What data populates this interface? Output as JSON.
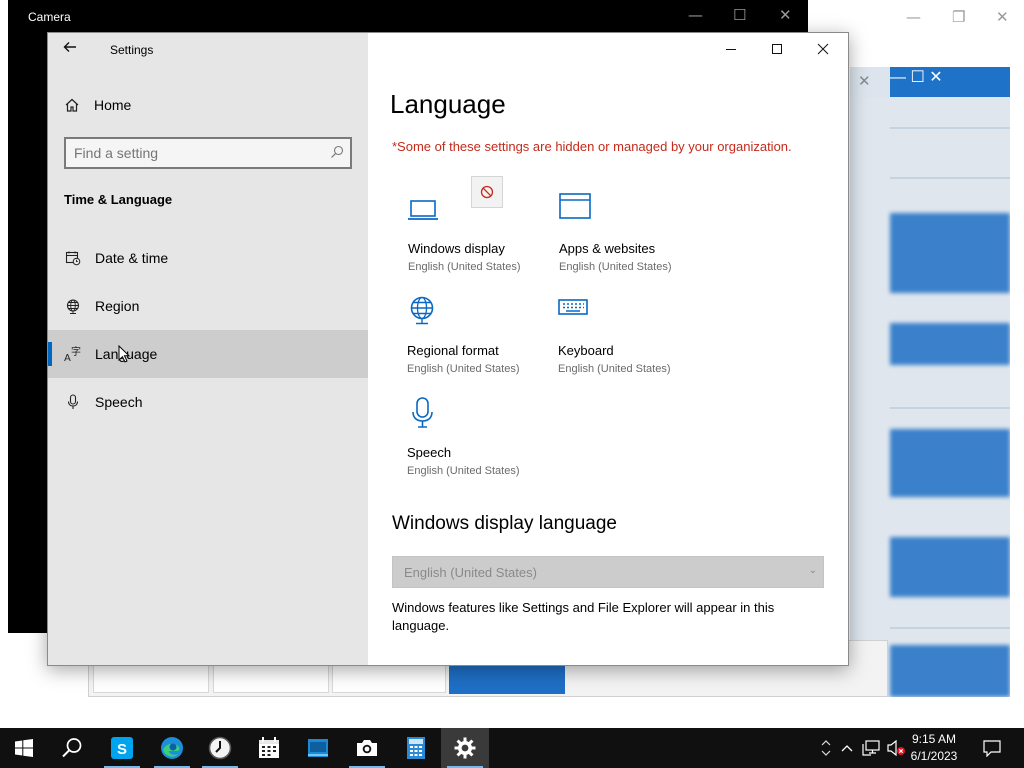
{
  "background": {
    "camera_window_title": "Camera"
  },
  "window": {
    "title": "Settings",
    "back_icon": "back-arrow-icon",
    "minimize_icon": "minimize-icon",
    "maximize_icon": "maximize-icon",
    "close_icon": "close-icon"
  },
  "sidebar": {
    "home_label": "Home",
    "search_placeholder": "Find a setting",
    "section_title": "Time & Language",
    "items": [
      {
        "label": "Date & time",
        "icon": "calendar-clock-icon"
      },
      {
        "label": "Region",
        "icon": "globe-icon"
      },
      {
        "label": "Language",
        "icon": "language-icon",
        "active": true
      },
      {
        "label": "Speech",
        "icon": "microphone-icon"
      }
    ]
  },
  "main": {
    "title": "Language",
    "warning": "*Some of these settings are hidden or managed by your organization.",
    "tiles": [
      {
        "label": "Windows display",
        "sub": "English (United States)",
        "icon": "laptop-icon"
      },
      {
        "label": "Apps & websites",
        "sub": "English (United States)",
        "icon": "browser-window-icon"
      },
      {
        "label": "Regional format",
        "sub": "English (United States)",
        "icon": "globe-icon"
      },
      {
        "label": "Keyboard",
        "sub": "English (United States)",
        "icon": "keyboard-icon"
      },
      {
        "label": "Speech",
        "sub": "English (United States)",
        "icon": "microphone-icon"
      }
    ],
    "display_language_heading": "Windows display language",
    "display_language_value": "English (United States)",
    "display_language_desc": "Windows features like Settings and File Explorer will appear in this language."
  },
  "taskbar": {
    "time": "9:15 AM",
    "date": "6/1/2023",
    "apps": [
      "windows-start-icon",
      "search-icon",
      "skype-icon",
      "edge-icon",
      "clock-app-icon",
      "calendar-icon",
      "file-explorer-icon",
      "camera-icon",
      "calculator-icon",
      "settings-gear-icon"
    ]
  },
  "colors": {
    "accent": "#0067c0",
    "icon_blue": "#0a68c4",
    "warning_red": "#c42b1c",
    "taskbar": "#101010"
  }
}
